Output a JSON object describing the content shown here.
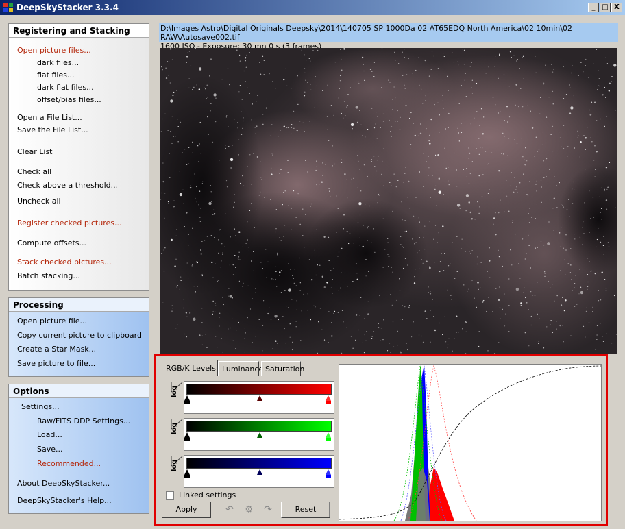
{
  "window": {
    "title": "DeepSkyStacker 3.3.4",
    "minimize": "_",
    "maximize": "□",
    "close": "X"
  },
  "registering": {
    "header": "Registering and Stacking",
    "open_picture_files": "Open picture files...",
    "dark_files": "dark files...",
    "flat_files": "flat files...",
    "dark_flat_files": "dark flat files...",
    "offset_bias_files": "offset/bias files...",
    "open_file_list": "Open a File List...",
    "save_file_list": "Save the File List...",
    "clear_list": "Clear List",
    "check_all": "Check all",
    "check_above_threshold": "Check above a threshold...",
    "uncheck_all": "Uncheck all",
    "register_checked": "Register checked pictures...",
    "compute_offsets": "Compute offsets...",
    "stack_checked": "Stack checked pictures...",
    "batch_stacking": "Batch stacking..."
  },
  "processing": {
    "header": "Processing",
    "open_picture_file": "Open picture file...",
    "copy_to_clipboard": "Copy current picture to clipboard",
    "create_star_mask": "Create a Star Mask...",
    "save_picture": "Save picture to file..."
  },
  "options": {
    "header": "Options",
    "settings": "Settings...",
    "raw_fits": "Raw/FITS DDP Settings...",
    "load": "Load...",
    "save": "Save...",
    "recommended": "Recommended...",
    "about": "About DeepSkyStacker...",
    "help": "DeepSkyStacker's Help..."
  },
  "file_info": {
    "path": "D:\\Images Astro\\Digital Originals Deepsky\\2014\\140705 SP 1000Da 02 AT65EDQ North America\\02 10min\\02 RAW\\Autosave002.tif",
    "details": "1600 ISO - Exposure: 30 mn 0 s (3 frames)"
  },
  "levels": {
    "tabs": [
      "RGB/K Levels",
      "Luminance",
      "Saturation"
    ],
    "log_label": "log",
    "linked_settings": "Linked settings",
    "apply": "Apply",
    "reset": "Reset",
    "channels": [
      {
        "name": "red",
        "color": "#ff0000"
      },
      {
        "name": "green",
        "color": "#00ff00"
      },
      {
        "name": "blue",
        "color": "#0000ff"
      }
    ]
  },
  "colors": {
    "accent_red": "#b4270b",
    "frame_red": "#e00000",
    "title_blue": "#0a246a",
    "info_blue": "#a6caf0"
  }
}
